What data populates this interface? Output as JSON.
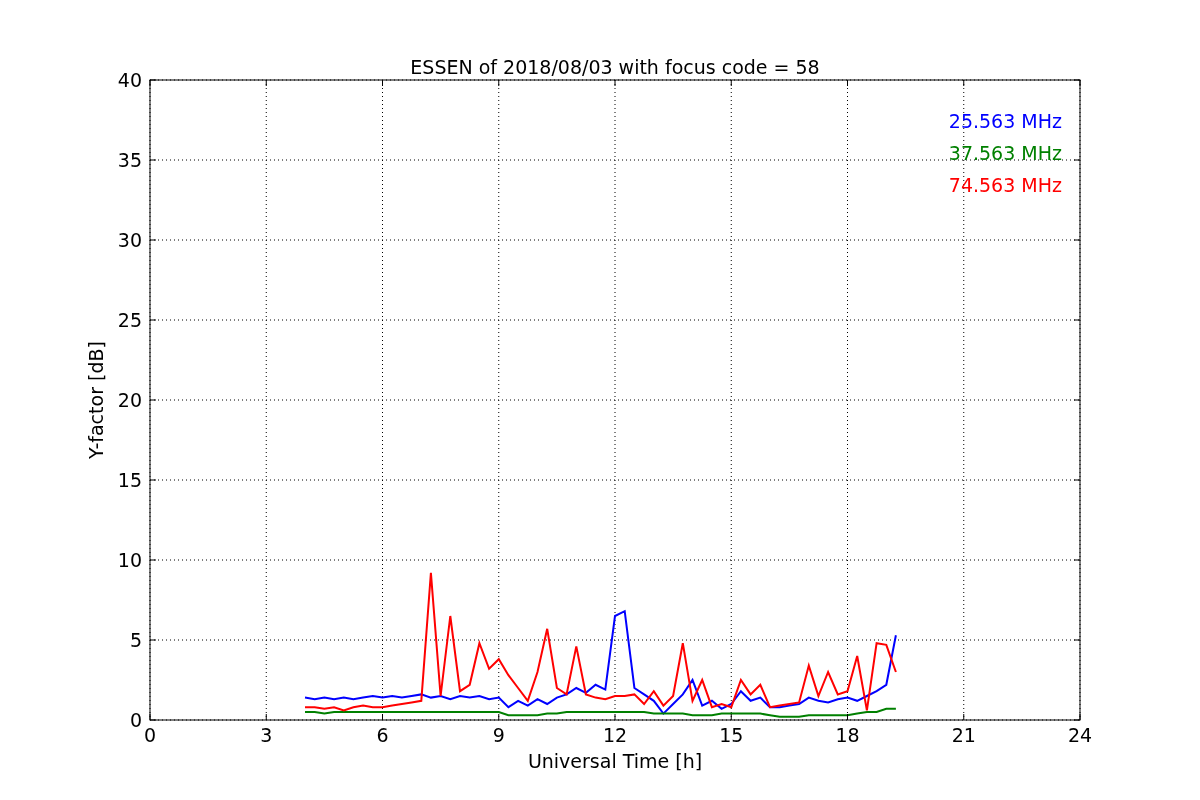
{
  "figure": {
    "chart_data": {
      "type": "line",
      "title": "ESSEN of 2018/08/03 with focus code = 58",
      "xlabel": "Universal Time [h]",
      "ylabel": "Y-factor [dB]",
      "x": [
        4,
        4.25,
        4.5,
        4.75,
        5,
        5.25,
        5.5,
        5.75,
        6,
        6.25,
        6.5,
        6.75,
        7,
        7.25,
        7.5,
        7.75,
        8,
        8.25,
        8.5,
        8.75,
        9,
        9.25,
        9.5,
        9.75,
        10,
        10.25,
        10.5,
        10.75,
        11,
        11.25,
        11.5,
        11.75,
        12,
        12.25,
        12.5,
        12.75,
        13,
        13.25,
        13.5,
        13.75,
        14,
        14.25,
        14.5,
        14.75,
        15,
        15.25,
        15.5,
        15.75,
        16,
        16.25,
        16.5,
        16.75,
        17,
        17.25,
        17.5,
        17.75,
        18,
        18.25,
        18.5,
        18.75,
        19,
        19.25
      ],
      "series": [
        {
          "name": "25.563 MHz",
          "color": "#0000ff",
          "values": [
            1.4,
            1.3,
            1.4,
            1.3,
            1.4,
            1.3,
            1.4,
            1.5,
            1.4,
            1.5,
            1.4,
            1.5,
            1.6,
            1.4,
            1.5,
            1.3,
            1.5,
            1.4,
            1.5,
            1.3,
            1.4,
            0.8,
            1.2,
            0.9,
            1.3,
            1.0,
            1.4,
            1.6,
            2.0,
            1.7,
            2.2,
            1.9,
            6.5,
            6.8,
            2.0,
            1.6,
            1.2,
            0.4,
            1.0,
            1.6,
            2.5,
            0.9,
            1.2,
            0.7,
            1.0,
            1.8,
            1.2,
            1.4,
            0.8,
            0.8,
            0.9,
            1.0,
            1.4,
            1.2,
            1.1,
            1.3,
            1.4,
            1.2,
            1.5,
            1.8,
            2.2,
            5.3
          ]
        },
        {
          "name": "37.563 MHz",
          "color": "#008000",
          "values": [
            0.5,
            0.5,
            0.4,
            0.5,
            0.5,
            0.5,
            0.5,
            0.5,
            0.5,
            0.5,
            0.5,
            0.5,
            0.5,
            0.5,
            0.5,
            0.5,
            0.5,
            0.5,
            0.5,
            0.5,
            0.5,
            0.3,
            0.3,
            0.3,
            0.3,
            0.4,
            0.4,
            0.5,
            0.5,
            0.5,
            0.5,
            0.5,
            0.5,
            0.5,
            0.5,
            0.5,
            0.4,
            0.4,
            0.4,
            0.4,
            0.3,
            0.3,
            0.3,
            0.4,
            0.4,
            0.4,
            0.4,
            0.4,
            0.3,
            0.2,
            0.2,
            0.2,
            0.3,
            0.3,
            0.3,
            0.3,
            0.3,
            0.4,
            0.5,
            0.5,
            0.7,
            0.7
          ]
        },
        {
          "name": "74.563 MHz",
          "color": "#ff0000",
          "values": [
            0.8,
            0.8,
            0.7,
            0.8,
            0.6,
            0.8,
            0.9,
            0.8,
            0.8,
            0.9,
            1.0,
            1.1,
            1.2,
            9.2,
            1.5,
            6.5,
            1.8,
            2.2,
            4.8,
            3.2,
            3.8,
            2.8,
            2.0,
            1.2,
            3.0,
            5.7,
            2.0,
            1.6,
            4.6,
            1.6,
            1.4,
            1.3,
            1.5,
            1.5,
            1.6,
            1.0,
            1.8,
            0.9,
            1.5,
            4.8,
            1.2,
            2.5,
            0.8,
            1.0,
            0.8,
            2.5,
            1.6,
            2.2,
            0.8,
            0.9,
            1.0,
            1.1,
            3.4,
            1.5,
            3.0,
            1.6,
            1.8,
            4.0,
            0.6,
            4.8,
            4.7,
            3.0
          ]
        }
      ],
      "grid": true,
      "xlim": [
        0,
        24
      ],
      "ylim": [
        0,
        40
      ],
      "xticks": [
        0,
        3,
        6,
        9,
        12,
        15,
        18,
        21,
        24
      ],
      "yticks": [
        0,
        5,
        10,
        15,
        20,
        25,
        30,
        35,
        40
      ]
    }
  }
}
